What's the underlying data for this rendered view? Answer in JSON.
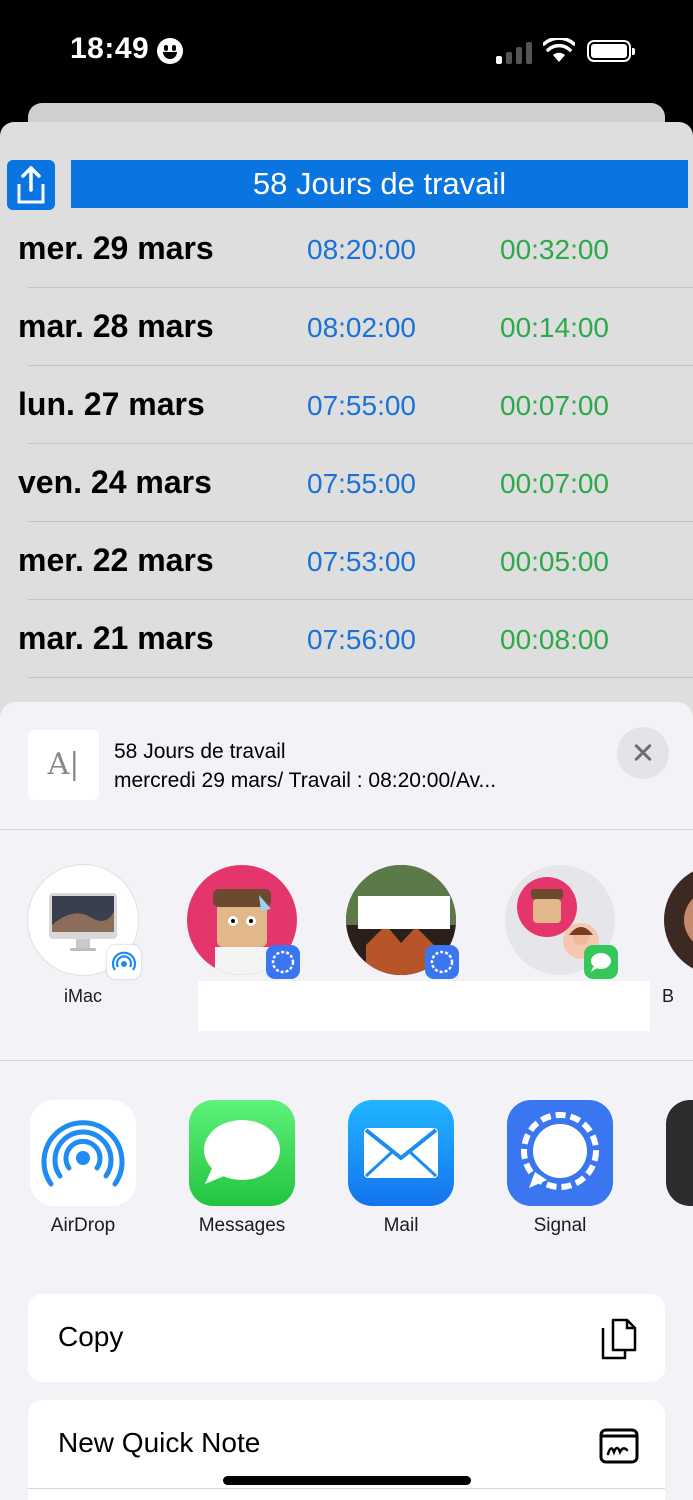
{
  "status_bar": {
    "time": "18:49"
  },
  "app": {
    "title": "58 Jours de travail",
    "rows": [
      {
        "date": "mer. 29 mars",
        "time1": "08:20:00",
        "time2": "00:32:00"
      },
      {
        "date": "mar. 28 mars",
        "time1": "08:02:00",
        "time2": "00:14:00"
      },
      {
        "date": "lun. 27 mars",
        "time1": "07:55:00",
        "time2": "00:07:00"
      },
      {
        "date": "ven. 24 mars",
        "time1": "07:55:00",
        "time2": "00:07:00"
      },
      {
        "date": "mer. 22 mars",
        "time1": "07:53:00",
        "time2": "00:05:00"
      },
      {
        "date": "mar. 21 mars",
        "time1": "07:56:00",
        "time2": "00:08:00"
      }
    ]
  },
  "share": {
    "preview_title": "58 Jours de travail",
    "preview_subtitle": "mercredi 29 mars/ Travail : 08:20:00/Av...",
    "contacts": [
      {
        "label": "iMac"
      },
      {
        "label": ""
      },
      {
        "label": ""
      },
      {
        "label": ""
      },
      {
        "label": "B"
      }
    ],
    "apps": [
      {
        "label": "AirDrop"
      },
      {
        "label": "Messages"
      },
      {
        "label": "Mail"
      },
      {
        "label": "Signal"
      }
    ],
    "actions": [
      {
        "label": "Copy"
      },
      {
        "label": "New Quick Note"
      }
    ]
  },
  "colors": {
    "accent_blue": "#0a74e0",
    "time_blue": "#1b72d6",
    "time_green": "#2da84a"
  }
}
